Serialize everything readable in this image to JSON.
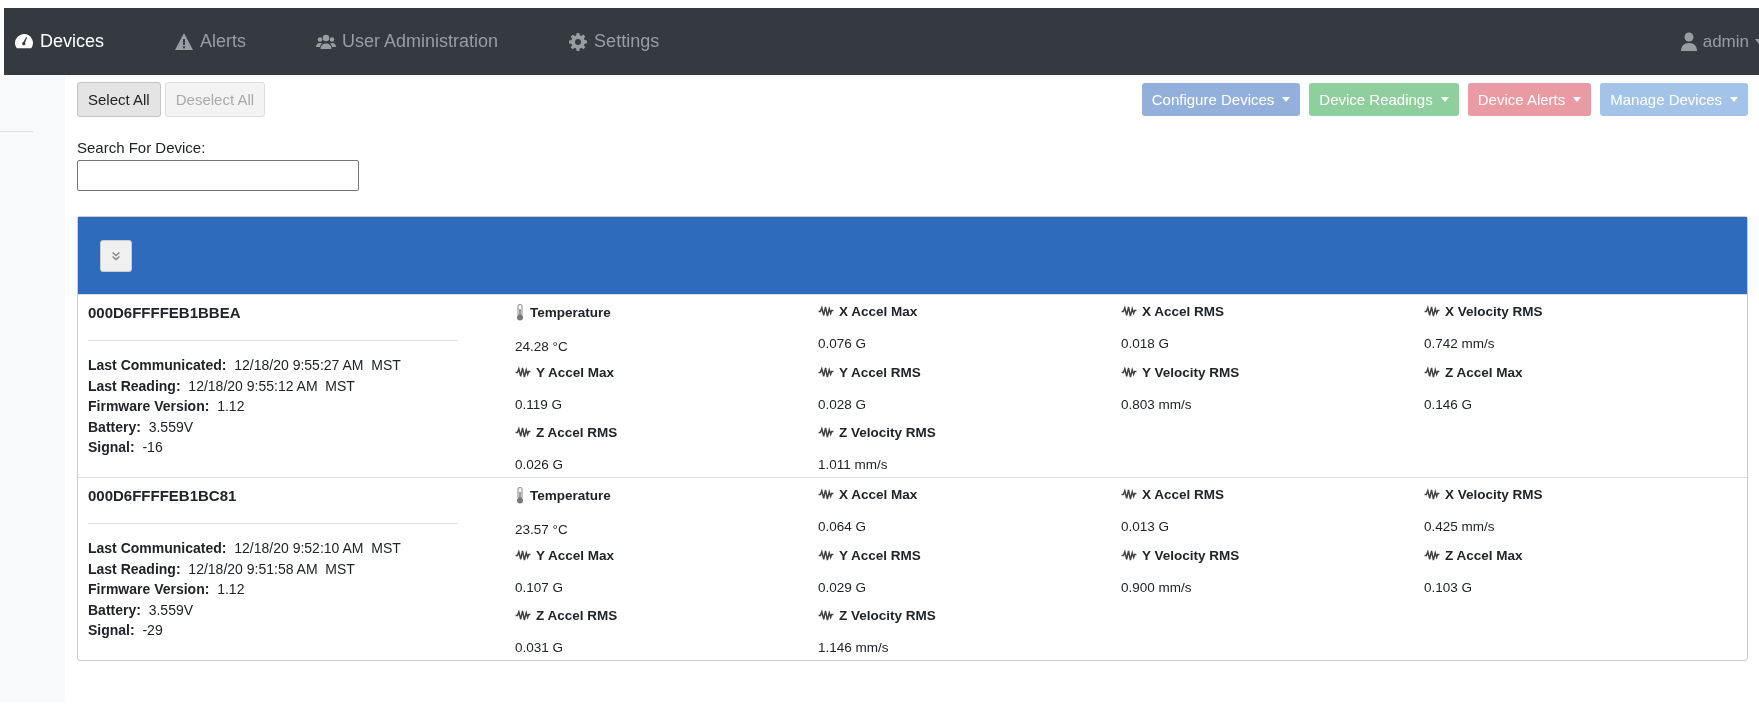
{
  "navbar": {
    "items": [
      {
        "label": "Devices",
        "selected": true
      },
      {
        "label": "Alerts",
        "selected": false
      },
      {
        "label": "User Administration",
        "selected": false
      },
      {
        "label": "Settings",
        "selected": false
      }
    ],
    "user": "admin"
  },
  "toolbar": {
    "selection_buttons": [
      {
        "label": "Select All",
        "disabled": false
      },
      {
        "label": "Deselect All",
        "disabled": true
      }
    ],
    "menu_buttons": [
      {
        "label": "Configure Devices",
        "color": "#93b0dc"
      },
      {
        "label": "Device Readings",
        "color": "#8fcf9d"
      },
      {
        "label": "Device Alerts",
        "color": "#e99aa2"
      },
      {
        "label": "Manage Devices",
        "color": "#a3c3e8"
      }
    ]
  },
  "search": {
    "label": "Search For Device:"
  },
  "devices": [
    {
      "id": "000D6FFFFEB1BBEA",
      "info": [
        {
          "label": "Last Communicated:",
          "value": "12/18/20 9:55:27 AM  MST"
        },
        {
          "label": "Last Reading:",
          "value": "12/18/20 9:55:12 AM  MST"
        },
        {
          "label": "Firmware Version:",
          "value": "1.12"
        },
        {
          "label": "Battery:",
          "value": "3.559V"
        },
        {
          "label": "Signal:",
          "value": "-16"
        }
      ],
      "readings": [
        {
          "kind": "temperature",
          "label": "Temperature",
          "value": "24.28 °C"
        },
        {
          "kind": "vibration",
          "label": "X Accel Max",
          "value": "0.076 G"
        },
        {
          "kind": "vibration",
          "label": "X Accel RMS",
          "value": "0.018 G"
        },
        {
          "kind": "vibration",
          "label": "X Velocity RMS",
          "value": "0.742 mm/s"
        },
        {
          "kind": "vibration",
          "label": "Y Accel Max",
          "value": "0.119 G"
        },
        {
          "kind": "vibration",
          "label": "Y Accel RMS",
          "value": "0.028 G"
        },
        {
          "kind": "vibration",
          "label": "Y Velocity RMS",
          "value": "0.803 mm/s"
        },
        {
          "kind": "vibration",
          "label": "Z Accel Max",
          "value": "0.146 G"
        },
        {
          "kind": "vibration",
          "label": "Z Accel RMS",
          "value": "0.026 G"
        },
        {
          "kind": "vibration",
          "label": "Z Velocity RMS",
          "value": "1.011 mm/s"
        }
      ]
    },
    {
      "id": "000D6FFFFEB1BC81",
      "info": [
        {
          "label": "Last Communicated:",
          "value": "12/18/20 9:52:10 AM  MST"
        },
        {
          "label": "Last Reading:",
          "value": "12/18/20 9:51:58 AM  MST"
        },
        {
          "label": "Firmware Version:",
          "value": "1.12"
        },
        {
          "label": "Battery:",
          "value": "3.559V"
        },
        {
          "label": "Signal:",
          "value": "-29"
        }
      ],
      "readings": [
        {
          "kind": "temperature",
          "label": "Temperature",
          "value": "23.57 °C"
        },
        {
          "kind": "vibration",
          "label": "X Accel Max",
          "value": "0.064 G"
        },
        {
          "kind": "vibration",
          "label": "X Accel RMS",
          "value": "0.013 G"
        },
        {
          "kind": "vibration",
          "label": "X Velocity RMS",
          "value": "0.425 mm/s"
        },
        {
          "kind": "vibration",
          "label": "Y Accel Max",
          "value": "0.107 G"
        },
        {
          "kind": "vibration",
          "label": "Y Accel RMS",
          "value": "0.029 G"
        },
        {
          "kind": "vibration",
          "label": "Y Velocity RMS",
          "value": "0.900 mm/s"
        },
        {
          "kind": "vibration",
          "label": "Z Accel Max",
          "value": "0.103 G"
        },
        {
          "kind": "vibration",
          "label": "Z Accel RMS",
          "value": "0.031 G"
        },
        {
          "kind": "vibration",
          "label": "Z Velocity RMS",
          "value": "1.146 mm/s"
        }
      ]
    }
  ]
}
